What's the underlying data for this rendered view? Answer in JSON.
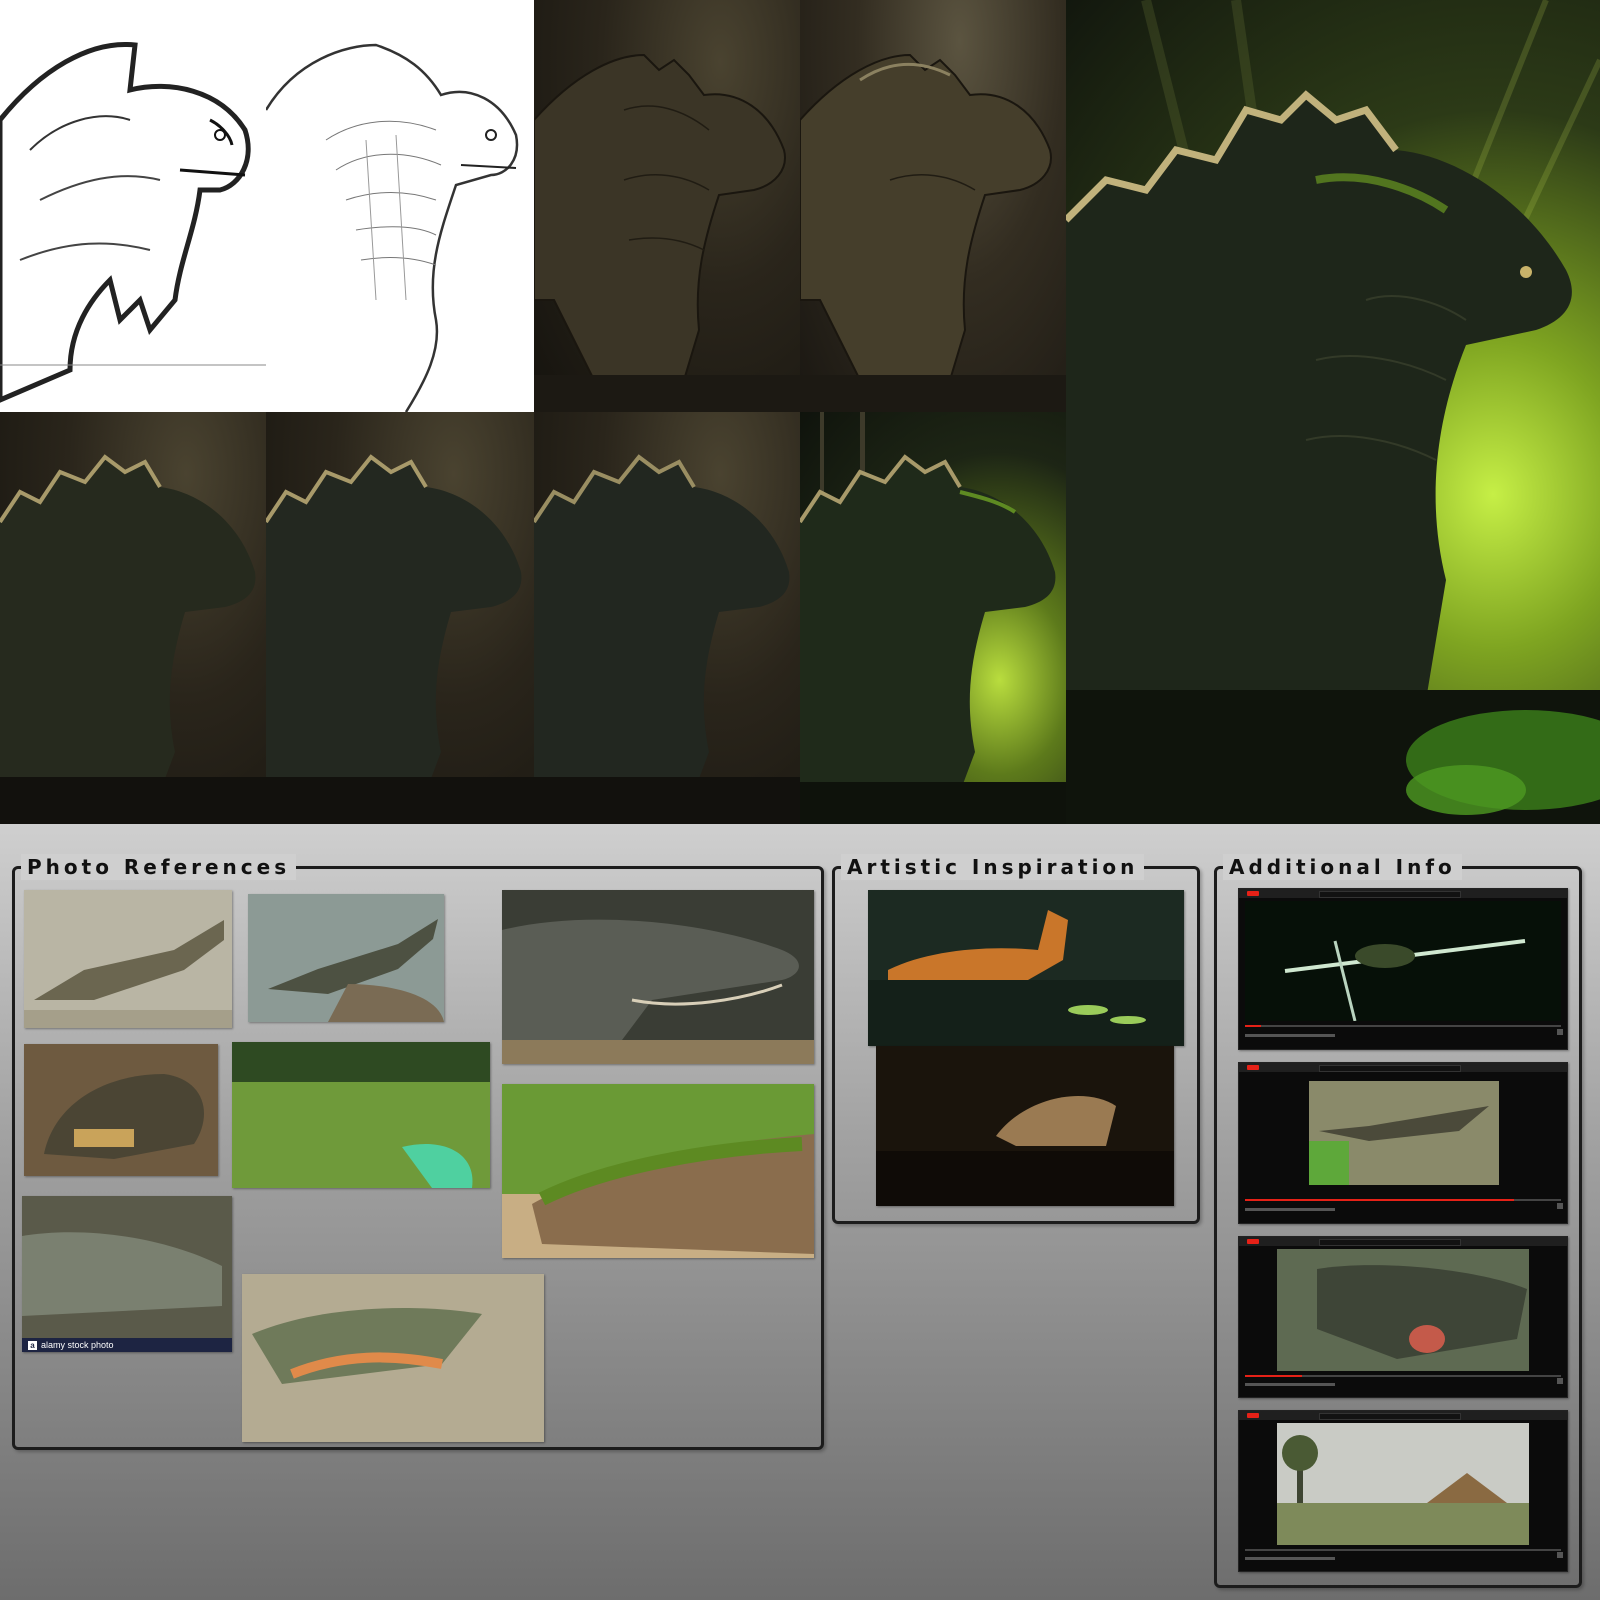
{
  "panels": {
    "photo_references": {
      "title": "Photo References"
    },
    "artistic_inspiration": {
      "title": "Artistic Inspiration"
    },
    "additional_info": {
      "title": "Additional Info"
    }
  },
  "photo_watermark": {
    "text": "alamy stock photo",
    "logo": "a"
  },
  "colors": {
    "panel_border": "#1c1c1c",
    "sketch_line": "#222222",
    "creature_dark": "#262a1e",
    "moss_green": "#7fa521",
    "glow_green": "#c6ef46",
    "youtube_red": "#e62117"
  },
  "icons": [
    "youtube-logo-icon",
    "play-icon",
    "settings-icon",
    "fullscreen-icon"
  ],
  "video_progress": [
    0.05,
    0.85,
    0.18,
    0.0
  ]
}
